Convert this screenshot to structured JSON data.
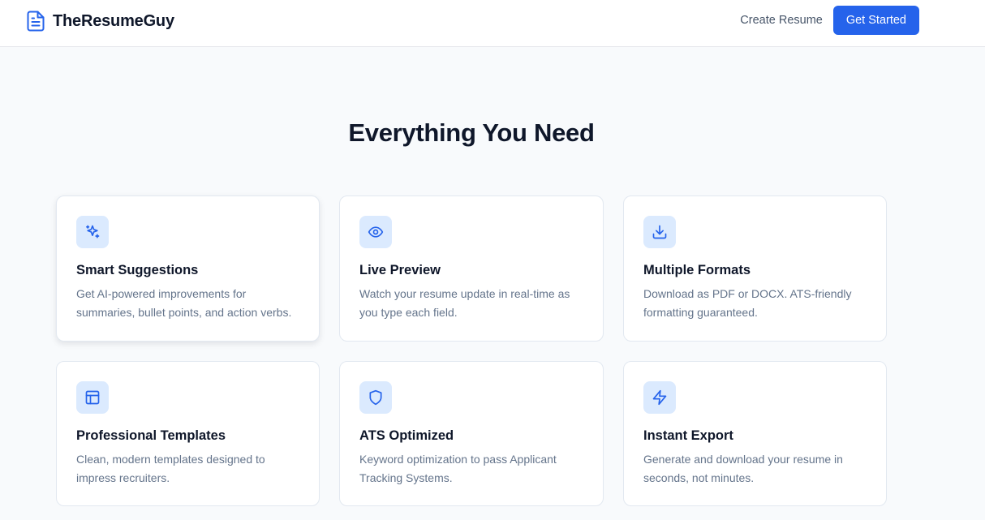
{
  "nav": {
    "brand": "TheResumeGuy",
    "brand_icon": "file-text-icon",
    "create_resume_label": "Create Resume",
    "get_started_label": "Get Started"
  },
  "features": {
    "title": "Everything You Need",
    "accent_color": "#2563eb",
    "icon_bg_color": "#dbeafe",
    "items": [
      {
        "icon": "sparkles-icon",
        "title": "Smart Suggestions",
        "description": "Get AI-powered improvements for summaries, bullet points, and action verbs."
      },
      {
        "icon": "eye-icon",
        "title": "Live Preview",
        "description": "Watch your resume update in real-time as you type each field."
      },
      {
        "icon": "download-icon",
        "title": "Multiple Formats",
        "description": "Download as PDF or DOCX. ATS-friendly formatting guaranteed."
      },
      {
        "icon": "layout-icon",
        "title": "Professional Templates",
        "description": "Clean, modern templates designed to impress recruiters."
      },
      {
        "icon": "shield-icon",
        "title": "ATS Optimized",
        "description": "Keyword optimization to pass Applicant Tracking Systems."
      },
      {
        "icon": "zap-icon",
        "title": "Instant Export",
        "description": "Generate and download your resume in seconds, not minutes."
      }
    ]
  }
}
